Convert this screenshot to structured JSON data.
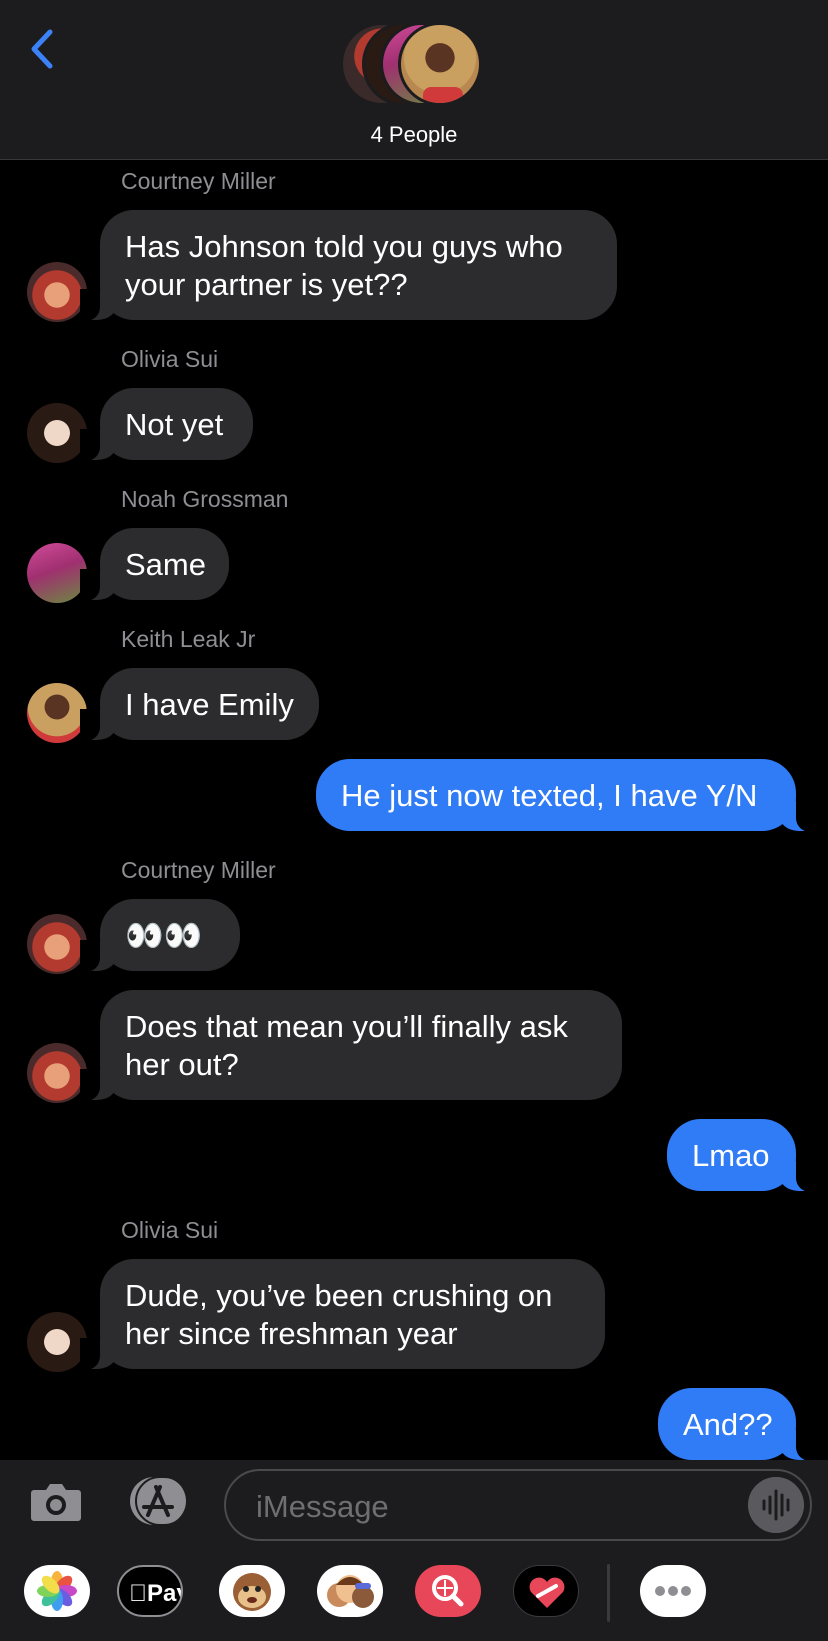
{
  "header": {
    "title": "4 People",
    "back_icon": "chevron-left-icon",
    "avatars": [
      "courtney-avatar",
      "olivia-avatar",
      "noah-avatar",
      "keith-avatar"
    ]
  },
  "messages": [
    {
      "sender": "Courtney Miller",
      "text": "Has Johnson told you guys who your partner is yet??",
      "direction": "in",
      "avatar": "courtney-avatar"
    },
    {
      "sender": "Olivia Sui",
      "text": "Not yet",
      "direction": "in",
      "avatar": "olivia-avatar"
    },
    {
      "sender": "Noah Grossman",
      "text": "Same",
      "direction": "in",
      "avatar": "noah-avatar"
    },
    {
      "sender": "Keith Leak Jr",
      "text": "I have Emily",
      "direction": "in",
      "avatar": "keith-avatar"
    },
    {
      "text": "He just now texted, I have Y/N",
      "direction": "out"
    },
    {
      "sender": "Courtney Miller",
      "text": "👀👀",
      "direction": "in",
      "avatar": "courtney-avatar"
    },
    {
      "text": "Does that mean you’ll finally ask her out?",
      "direction": "in",
      "avatar": "courtney-avatar"
    },
    {
      "text": "Lmao",
      "direction": "out"
    },
    {
      "sender": "Olivia Sui",
      "text": "Dude, you’ve been crushing on her since freshman year",
      "direction": "in",
      "avatar": "olivia-avatar"
    },
    {
      "text": "And??",
      "direction": "out"
    }
  ],
  "input": {
    "placeholder": "iMessage",
    "camera_icon": "camera-icon",
    "apps_icon": "app-store-icon",
    "audio_icon": "audio-waveform-icon"
  },
  "app_drawer": {
    "apple_pay_label": "Pay",
    "items": [
      "photos-icon",
      "apple-pay-icon",
      "animoji-icon",
      "memoji-icon",
      "image-search-icon",
      "digital-touch-icon",
      "more-icon"
    ]
  },
  "colors": {
    "outgoing": "#2f7cf6",
    "incoming": "#2c2c2e",
    "background": "#000000",
    "header": "#1c1c1e",
    "accent": "#3b82f6"
  }
}
